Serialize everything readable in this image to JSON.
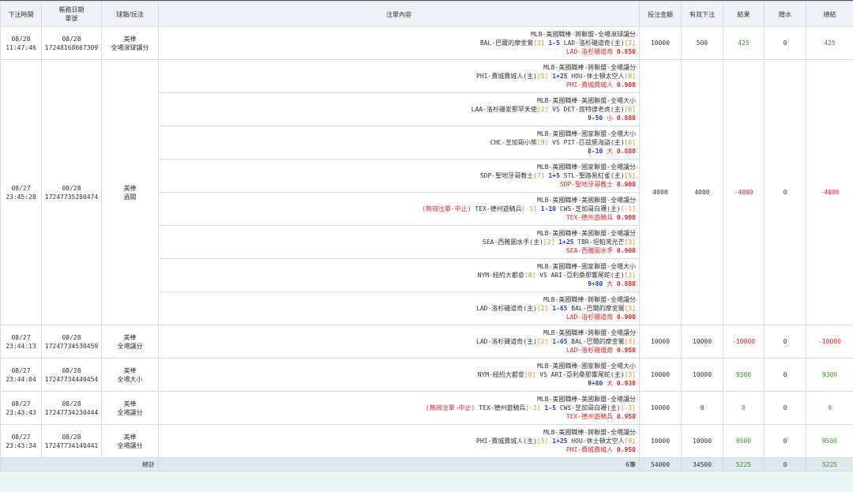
{
  "headers": [
    "下注時間",
    "帳務日期",
    "單號",
    "球類/玩法",
    "注單內容",
    "投注金額",
    "有效下注",
    "結果",
    "贈水",
    "總結"
  ],
  "void_label": "(無效注單-中止)",
  "rows": [
    {
      "date": "08/28",
      "time": "11:47:46",
      "acct_date": "08/28",
      "ticket": "17248168667309",
      "sport": "美棒",
      "play": "全場滾球讓分",
      "bets": [
        {
          "league": "MLB-美國職棒-跨聯盟-全場滾球讓分",
          "void": false,
          "team1": "BAL-巴爾的摩金鶯",
          "team1_score": "[3]",
          "line": "1-5",
          "team2": "LAD-洛杉磯道奇(主)",
          "team2_score": "[2]",
          "pick": "LAD-洛杉磯道奇",
          "odds": "0.850"
        }
      ],
      "amount": "10000",
      "valid": "500",
      "result": "425",
      "rebate": "0",
      "total": "425",
      "result_color": "green",
      "total_color": "green"
    },
    {
      "date": "08/27",
      "time": "23:45:28",
      "acct_date": "08/28",
      "ticket": "17247735280474",
      "sport": "美棒",
      "play": "過關",
      "bets": [
        {
          "league": "MLB-美國職棒-跨聯盟-全場讓分",
          "void": false,
          "team1": "PHI-費城費城人(主)",
          "team1_score": "[5]",
          "line": "1+25",
          "team2": "HOU-休士頓太空人",
          "team2_score": "[0]",
          "pick": "PHI-費城費城人",
          "odds": "0.900"
        },
        {
          "league": "MLB-美國職棒-美國聯盟-全場大小",
          "void": false,
          "team1": "LAA-洛杉磯安那罕天使",
          "team1_score": "[2]",
          "line": "VS",
          "team2": "DET-底特律老虎(主)",
          "team2_score": "[6]",
          "pick_line": "9-50",
          "pick": "小",
          "odds": "0.880"
        },
        {
          "league": "MLB-美國職棒-國家聯盟-全場大小",
          "void": false,
          "team1": "CHC-芝加哥小熊",
          "team1_score": "[9]",
          "line": "VS",
          "team2": "PIT-匹茲堡海盜(主)",
          "team2_score": "[6]",
          "pick_line": "8-10",
          "pick": "大",
          "odds": "0.880"
        },
        {
          "league": "MLB-美國職棒-國家聯盟-全場讓分",
          "void": false,
          "team1": "SDP-聖地牙哥教士",
          "team1_score": "[7]",
          "line": "1+5",
          "team2": "STL-聖路易紅雀(主)",
          "team2_score": "[5]",
          "pick": "SDP-聖地牙哥教士",
          "odds": "0.900"
        },
        {
          "league": "MLB-美國職棒-美國聯盟-全場讓分",
          "void": true,
          "team1": "TEX-德州遊騎兵",
          "team1_score": "[-1]",
          "line": "1-10",
          "team2": "CWS-芝加哥白襪(主)",
          "team2_score": "[-1]",
          "pick": "TEX-德州遊騎兵",
          "odds": "0.900"
        },
        {
          "league": "MLB-美國職棒-美國聯盟-全場讓分",
          "void": false,
          "team1": "SEA-西雅圖水手(主)",
          "team1_score": "[2]",
          "line": "1+25",
          "team2": "TBR-坦帕灣光芒",
          "team2_score": "[3]",
          "pick": "SEA-西雅圖水手",
          "odds": "0.900"
        },
        {
          "league": "MLB-美國職棒-國家聯盟-全場大小",
          "void": false,
          "team1": "NYM-紐約大都會",
          "team1_score": "[8]",
          "line": "VS",
          "team2": "ARI-亞利桑那響尾蛇(主)",
          "team2_score": "[3]",
          "pick_line": "9+80",
          "pick": "大",
          "odds": "0.880"
        },
        {
          "league": "MLB-美國職棒-跨聯盟-全場讓分",
          "void": false,
          "team1": "LAD-洛杉磯道奇(主)",
          "team1_score": "[2]",
          "line": "1-65",
          "team2": "BAL-巴爾的摩金鶯",
          "team2_score": "[3]",
          "pick": "LAD-洛杉磯道奇",
          "odds": "0.900"
        }
      ],
      "amount": "4000",
      "valid": "4000",
      "result": "-4000",
      "rebate": "0",
      "total": "-4000",
      "result_color": "red",
      "total_color": "red"
    },
    {
      "date": "08/27",
      "time": "23:44:13",
      "acct_date": "08/28",
      "ticket": "17247734530459",
      "sport": "美棒",
      "play": "全場讓分",
      "bets": [
        {
          "league": "MLB-美國職棒-跨聯盟-全場讓分",
          "void": false,
          "team1": "LAD-洛杉磯道奇(主)",
          "team1_score": "[2]",
          "line": "1-65",
          "team2": "BAL-巴爾的摩金鶯",
          "team2_score": "[3]",
          "pick": "LAD-洛杉磯道奇",
          "odds": "0.950"
        }
      ],
      "amount": "10000",
      "valid": "10000",
      "result": "-10000",
      "rebate": "0",
      "total": "-10000",
      "result_color": "red",
      "total_color": "red"
    },
    {
      "date": "08/27",
      "time": "23:44:04",
      "acct_date": "08/28",
      "ticket": "17247734440454",
      "sport": "美棒",
      "play": "全場大小",
      "bets": [
        {
          "league": "MLB-美國職棒-國家聯盟-全場大小",
          "void": false,
          "team1": "NYM-紐約大都會",
          "team1_score": "[8]",
          "line": "VS",
          "team2": "ARI-亞利桑那響尾蛇(主)",
          "team2_score": "[3]",
          "pick_line": "9+80",
          "pick": "大",
          "odds": "0.930"
        }
      ],
      "amount": "10000",
      "valid": "10000",
      "result": "9300",
      "rebate": "0",
      "total": "9300",
      "result_color": "green",
      "total_color": "green"
    },
    {
      "date": "08/27",
      "time": "23:43:43",
      "acct_date": "08/28",
      "ticket": "17247734230444",
      "sport": "美棒",
      "play": "全場讓分",
      "bets": [
        {
          "league": "MLB-美國職棒-美國聯盟-全場讓分",
          "void": true,
          "team1": "TEX-德州遊騎兵",
          "team1_score": "[-1]",
          "line": "1-5",
          "team2": "CWS-芝加哥白襪(主)",
          "team2_score": "[-1]",
          "pick": "TEX-德州遊騎兵",
          "odds": "0.950"
        }
      ],
      "amount": "10000",
      "valid": "0",
      "result": "0",
      "rebate": "0",
      "total": "0",
      "result_color": "green",
      "total_color": "green"
    },
    {
      "date": "08/27",
      "time": "23:43:34",
      "acct_date": "08/28",
      "ticket": "17247734140441",
      "sport": "美棒",
      "play": "全場讓分",
      "bets": [
        {
          "league": "MLB-美國職棒-跨聯盟-全場讓分",
          "void": false,
          "team1": "PHI-費城費城人(主)",
          "team1_score": "[5]",
          "line": "1+25",
          "team2": "HOU-休士頓太空人",
          "team2_score": "[0]",
          "pick": "PHI-費城費城人",
          "odds": "0.950"
        }
      ],
      "amount": "10000",
      "valid": "10000",
      "result": "9500",
      "rebate": "0",
      "total": "9500",
      "result_color": "green",
      "total_color": "green"
    }
  ],
  "footer": {
    "label": "總計",
    "count": "6筆",
    "amount": "54000",
    "valid": "34500",
    "result": "5225",
    "rebate": "0",
    "total": "5225"
  }
}
